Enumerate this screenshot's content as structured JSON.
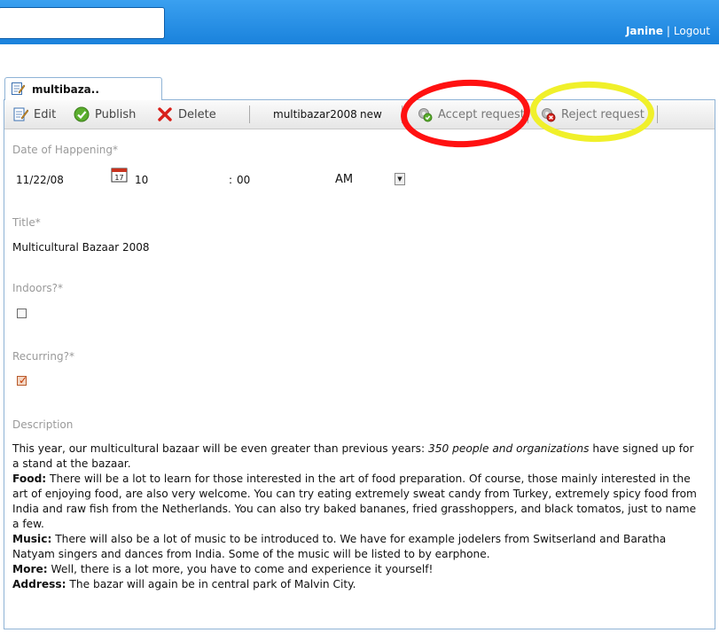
{
  "header": {
    "search_value": "",
    "user": "Janine",
    "separator": "|",
    "logout": "Logout"
  },
  "tab": {
    "label": "multibaza.."
  },
  "toolbar": {
    "edit": "Edit",
    "publish": "Publish",
    "delete": "Delete",
    "doc_name": "multibazar2008",
    "doc_status": "new",
    "accept": "Accept request",
    "reject": "Reject request"
  },
  "form": {
    "date_label": "Date of Happening*",
    "date_value": "11/22/08",
    "hour": "10",
    "colon": ":",
    "minute": "00",
    "ampm": "AM",
    "title_label": "Title*",
    "title_value": "Multicultural Bazaar 2008",
    "indoors_label": "Indoors?*",
    "indoors_checked": false,
    "recurring_label": "Recurring?*",
    "recurring_checked": true,
    "description_label": "Description"
  },
  "description": {
    "intro_a": "This year, our multicultural bazaar will be even greater than previous years: ",
    "intro_em": "350 people and organizations",
    "intro_b": " have signed up for a stand at the bazaar.",
    "food_label": "Food:",
    "food_text": " There will be a lot to learn for those interested in the art of food preparation. Of course, those mainly interested in the art of enjoying food, are also very welcome. You can try eating extremely sweat candy from Turkey, extremely spicy food from India and raw fish from the Netherlands. You can also try baked bananes, fried grasshoppers, and black tomatos, just to name a few.",
    "music_label": "Music:",
    "music_text": " There will also be a lot of music to be introduced to. We have for example jodelers from Switserland and Baratha Natyam singers and dances from India. Some of the music will be listed to by earphone.",
    "more_label": "More:",
    "more_text": " Well, there is a lot more, you have to come and experience it yourself!",
    "address_label": "Address:",
    "address_text": " The bazar will again be in central park of Malvin City."
  },
  "colors": {
    "header_blue": "#1a82dc",
    "annotation_red": "#ff1111",
    "annotation_yellow": "#f0f02a"
  }
}
